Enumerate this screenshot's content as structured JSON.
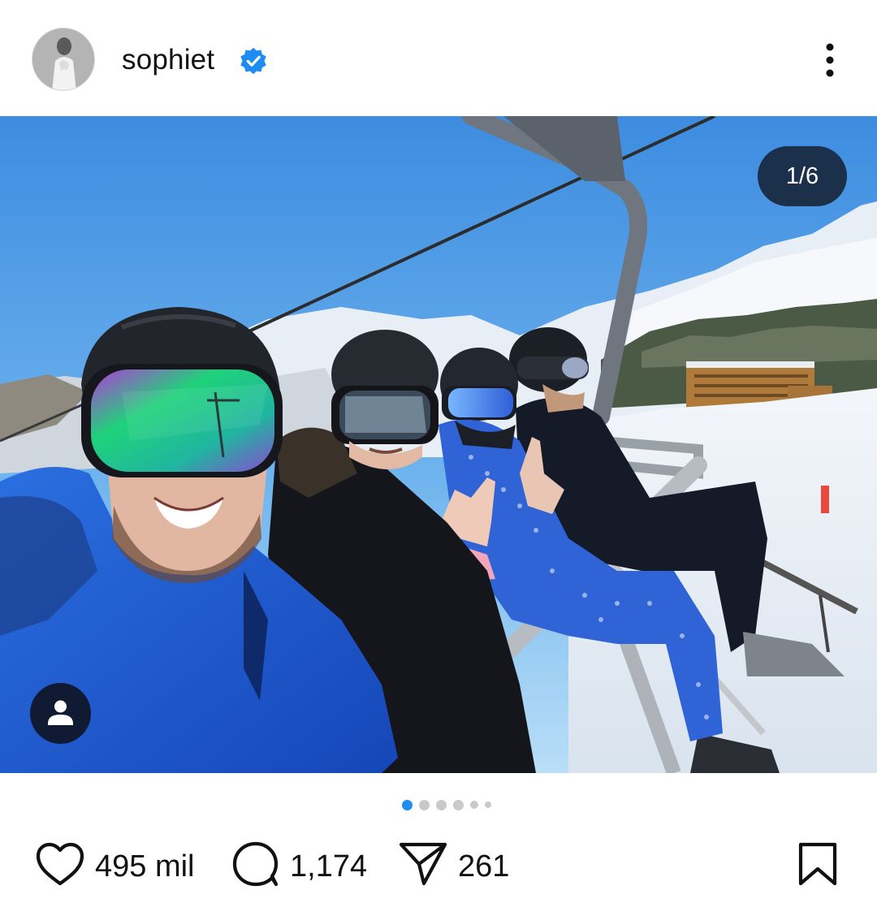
{
  "post": {
    "username": "sophiet",
    "verified": true,
    "counter": "1/6",
    "carousel_active_index": 0,
    "carousel_dots": 6
  },
  "actions": {
    "likes": "495 mil",
    "comments": "1,174",
    "shares": "261"
  },
  "icons": {
    "like": "heart-icon",
    "comment": "comment-icon",
    "share": "send-icon",
    "save": "bookmark-icon",
    "more": "more-vertical-icon",
    "verified": "verified-badge-icon",
    "tag": "user-tag-icon"
  },
  "colors": {
    "verified_blue": "#1f8cf2",
    "active_dot": "#1e8ff0",
    "inactive_dot": "#c9c9c9"
  }
}
